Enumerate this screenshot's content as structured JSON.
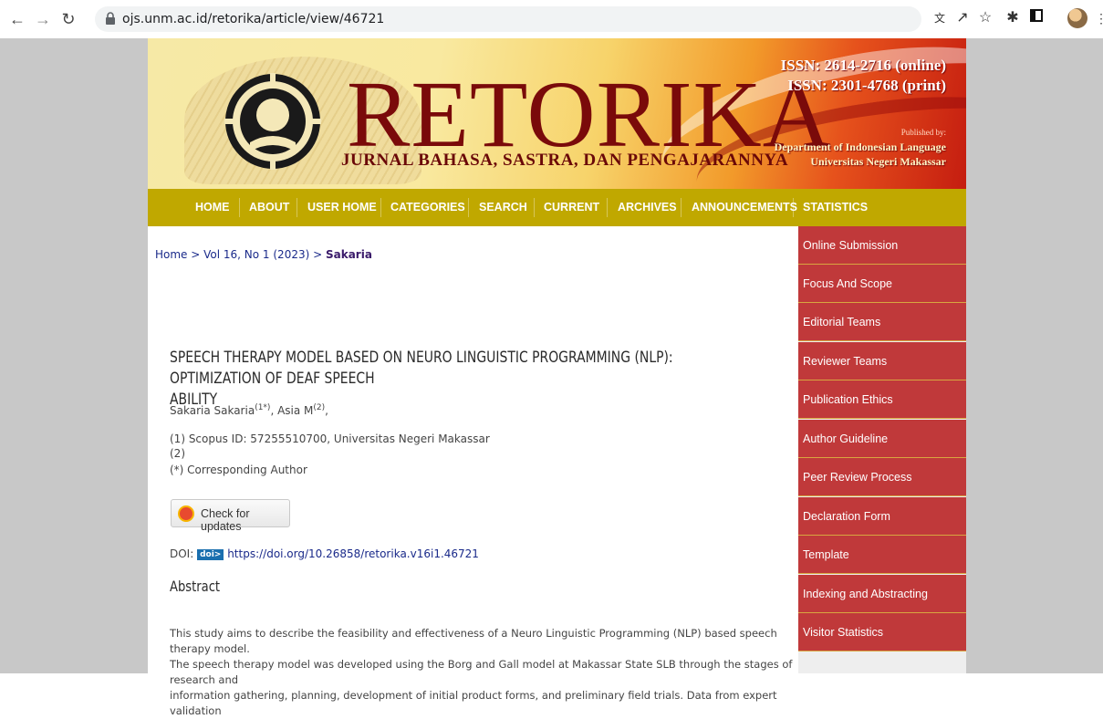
{
  "browser": {
    "url": "ojs.unm.ac.id/retorika/article/view/46721",
    "icons": [
      "back-arrow-icon",
      "forward-arrow-icon",
      "reload-icon",
      "lock-icon",
      "translate-icon",
      "share-icon",
      "bookmark-star-icon",
      "extensions-puzzle-icon",
      "side-panel-icon",
      "profile-avatar",
      "menu-kebab-icon"
    ]
  },
  "banner": {
    "brand": "RETORIKA",
    "tagline": "JURNAL BAHASA, SASTRA, DAN PENGAJARANNYA",
    "issn_online": "ISSN: 2614-2716 (online)",
    "issn_print": "ISSN: 2301-4768 (print)",
    "published_by": "Published by:",
    "department": "Department of Indonesian Language",
    "university": "Universitas Negeri Makassar"
  },
  "menu": [
    "HOME",
    "ABOUT",
    "USER HOME",
    "CATEGORIES",
    "SEARCH",
    "CURRENT",
    "ARCHIVES",
    "ANNOUNCEMENTS",
    "STATISTICS"
  ],
  "breadcrumb": {
    "home": "Home",
    "sep": " > ",
    "issue": "Vol 16, No 1 (2023)",
    "current": "Sakaria"
  },
  "article": {
    "title_line1": "SPEECH THERAPY MODEL BASED ON NEURO LINGUISTIC PROGRAMMING (NLP): OPTIMIZATION OF DEAF SPEECH",
    "title_line2": "ABILITY",
    "author1": "Sakaria Sakaria",
    "author1_sup": "(1*)",
    "author2": "Asia M",
    "author2_sup": "(2)",
    "affiliation1": "(1) Scopus ID: 57255510700, Universitas Negeri Makassar",
    "affiliation2": "(2)",
    "corresponding": "(*) Corresponding Author",
    "check_updates": "Check for updates",
    "doi_label": "DOI: ",
    "doi_badge": "doi>",
    "doi_link": "https://doi.org/10.26858/retorika.v16i1.46721",
    "abstract_heading": "Abstract",
    "abstract_line1": "This study aims to describe the feasibility and effectiveness of a Neuro Linguistic Programming (NLP) based speech therapy model.",
    "abstract_line2": "The speech therapy model was developed using the Borg and Gall model at Makassar State SLB through the stages of research and",
    "abstract_line3": "information gathering, planning, development of initial product forms, and preliminary field trials. Data from expert validation"
  },
  "sidebar": [
    "Online Submission",
    "Focus And Scope",
    "Editorial Teams",
    "Reviewer Teams",
    "Publication Ethics",
    "Author Guideline",
    "Peer Review Process",
    "Declaration Form",
    "Template",
    "Indexing and Abstracting",
    "Visitor Statistics"
  ]
}
